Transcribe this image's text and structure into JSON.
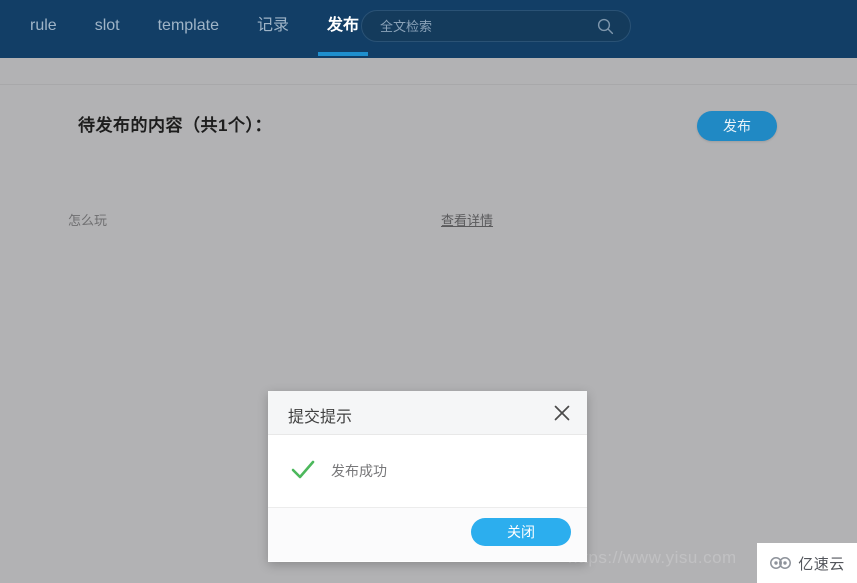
{
  "nav": {
    "tabs": [
      {
        "label": "rule",
        "active": false
      },
      {
        "label": "slot",
        "active": false
      },
      {
        "label": "template",
        "active": false
      },
      {
        "label": "记录",
        "active": false
      },
      {
        "label": "发布",
        "active": true
      }
    ],
    "search": {
      "placeholder": "全文检索",
      "value": "",
      "icon": "search-icon"
    },
    "background_color": "#123e66",
    "active_underline_color": "#1e8fce"
  },
  "main": {
    "section_title": "待发布的内容（共1个）：",
    "publish_button_label": "发布",
    "publish_button_color": "#2089c4",
    "rows": [
      {
        "name": "怎么玩",
        "detail_link": "查看详情"
      }
    ],
    "background_color": "#b2b2b4"
  },
  "modal": {
    "title": "提交提示",
    "close_icon": "close-icon",
    "status_icon": "check-icon",
    "status_icon_color": "#4cb85c",
    "message": "发布成功",
    "footer_button_label": "关闭",
    "footer_button_color": "#2caeee"
  },
  "watermark": {
    "badge_text": "亿速云",
    "logo_icon": "cloud-logo-icon",
    "background_text": "https://www.yisu.com"
  }
}
